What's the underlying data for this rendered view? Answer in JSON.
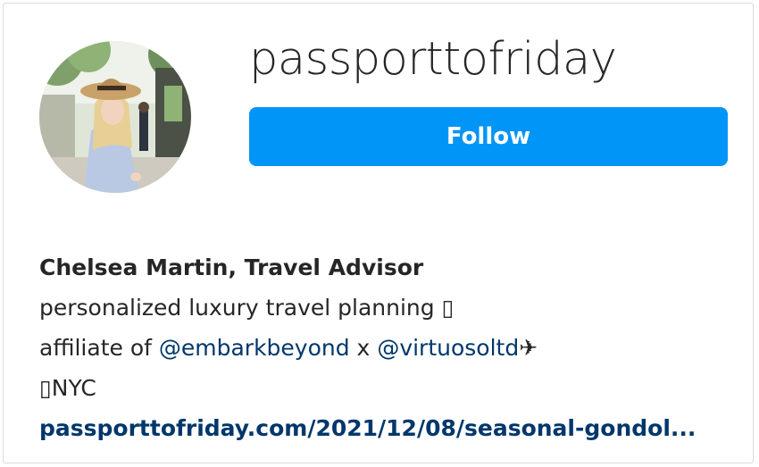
{
  "profile": {
    "username": "passporttofriday",
    "follow_label": "Follow",
    "full_name": "Chelsea Martin, Travel Advisor",
    "bio": {
      "line1": "personalized luxury travel planning ▯",
      "line2_prefix": "affiliate of ",
      "mention1": "@embarkbeyond",
      "line2_middle": " x ",
      "mention2": "@virtuosoltd",
      "line2_suffix": " ✈",
      "line3": "▯NYC"
    },
    "website": "passporttofriday.com/2021/12/08/seasonal-gondol..."
  },
  "colors": {
    "button": "#0095f6",
    "link": "#00376b",
    "text": "#262626"
  }
}
